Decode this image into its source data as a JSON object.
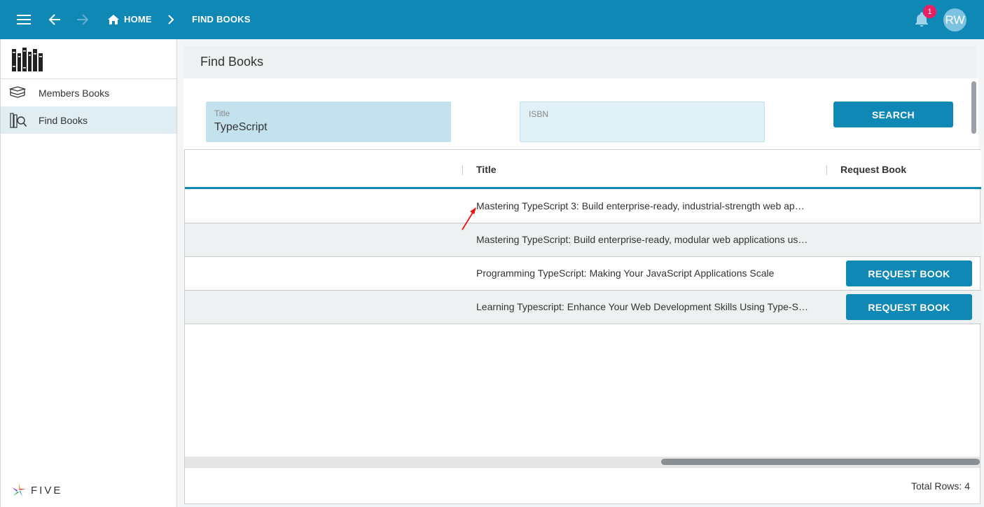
{
  "header": {
    "breadcrumb_home": "HOME",
    "breadcrumb_current": "FIND BOOKS",
    "notification_count": "1",
    "avatar_initials": "RW",
    "accent_color": "#0f88b6"
  },
  "sidebar": {
    "items": [
      {
        "label": "Members Books",
        "icon": "books-stack-icon",
        "active": false
      },
      {
        "label": "Find Books",
        "icon": "book-search-icon",
        "active": true
      }
    ],
    "brand": "FIVE"
  },
  "page": {
    "title": "Find Books"
  },
  "form": {
    "title_label": "Title",
    "title_value": "TypeScript",
    "isbn_label": "ISBN",
    "isbn_value": "",
    "search_label": "SEARCH"
  },
  "table": {
    "columns": [
      "",
      "Title",
      "Request Book"
    ],
    "rows": [
      {
        "title": "Mastering TypeScript 3: Build enterprise-ready, industrial-strength web ap…",
        "button": ""
      },
      {
        "title": "Mastering TypeScript: Build enterprise-ready, modular web applications us…",
        "button": ""
      },
      {
        "title": "Programming TypeScript: Making Your JavaScript Applications Scale",
        "button": "REQUEST BOOK"
      },
      {
        "title": "Learning Typescript: Enhance Your Web Development Skills Using Type-Sa…",
        "button": "REQUEST BOOK"
      }
    ],
    "total_rows": "Total Rows: 4"
  }
}
